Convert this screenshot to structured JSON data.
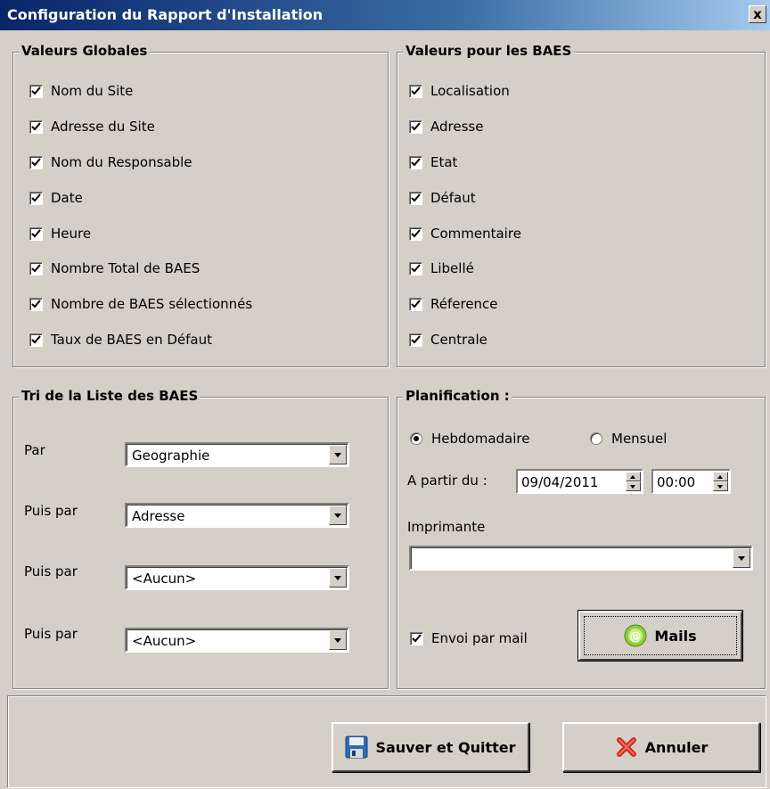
{
  "window": {
    "title": "Configuration du Rapport d'Installation",
    "close_label": "x"
  },
  "global_values": {
    "title": "Valeurs Globales",
    "items": [
      {
        "label": "Nom du Site",
        "checked": true
      },
      {
        "label": "Adresse du Site",
        "checked": true
      },
      {
        "label": "Nom du Responsable",
        "checked": true
      },
      {
        "label": "Date",
        "checked": true
      },
      {
        "label": "Heure",
        "checked": true
      },
      {
        "label": "Nombre Total de BAES",
        "checked": true
      },
      {
        "label": "Nombre de BAES sélectionnés",
        "checked": true
      },
      {
        "label": "Taux de BAES en Défaut",
        "checked": true
      }
    ]
  },
  "baes_values": {
    "title": "Valeurs pour les BAES",
    "items": [
      {
        "label": "Localisation",
        "checked": true
      },
      {
        "label": "Adresse",
        "checked": true
      },
      {
        "label": "Etat",
        "checked": true
      },
      {
        "label": "Défaut",
        "checked": true
      },
      {
        "label": "Commentaire",
        "checked": true
      },
      {
        "label": "Libellé",
        "checked": true
      },
      {
        "label": "Réference",
        "checked": true
      },
      {
        "label": "Centrale",
        "checked": true
      }
    ]
  },
  "sort": {
    "title": "Tri de la Liste des BAES",
    "rows": [
      {
        "label": "Par",
        "value": "Geographie"
      },
      {
        "label": "Puis par",
        "value": "Adresse"
      },
      {
        "label": "Puis par",
        "value": "<Aucun>"
      },
      {
        "label": "Puis par",
        "value": "<Aucun>"
      }
    ]
  },
  "planning": {
    "title": "Planification :",
    "weekly_label": "Hebdomadaire",
    "monthly_label": "Mensuel",
    "selected": "Hebdomadaire",
    "from_label": "A partir du :",
    "date_value": "09/04/2011",
    "time_value": "00:00",
    "printer_label": "Imprimante",
    "printer_value": "",
    "mail_label": "Envoi par mail",
    "mail_checked": true,
    "mails_button": "Mails"
  },
  "footer": {
    "save_button": "Sauver et Quitter",
    "cancel_button": "Annuler"
  },
  "colors": {
    "title_start": "#0a246a",
    "title_end": "#a6caf0",
    "face": "#d4d0c8"
  }
}
